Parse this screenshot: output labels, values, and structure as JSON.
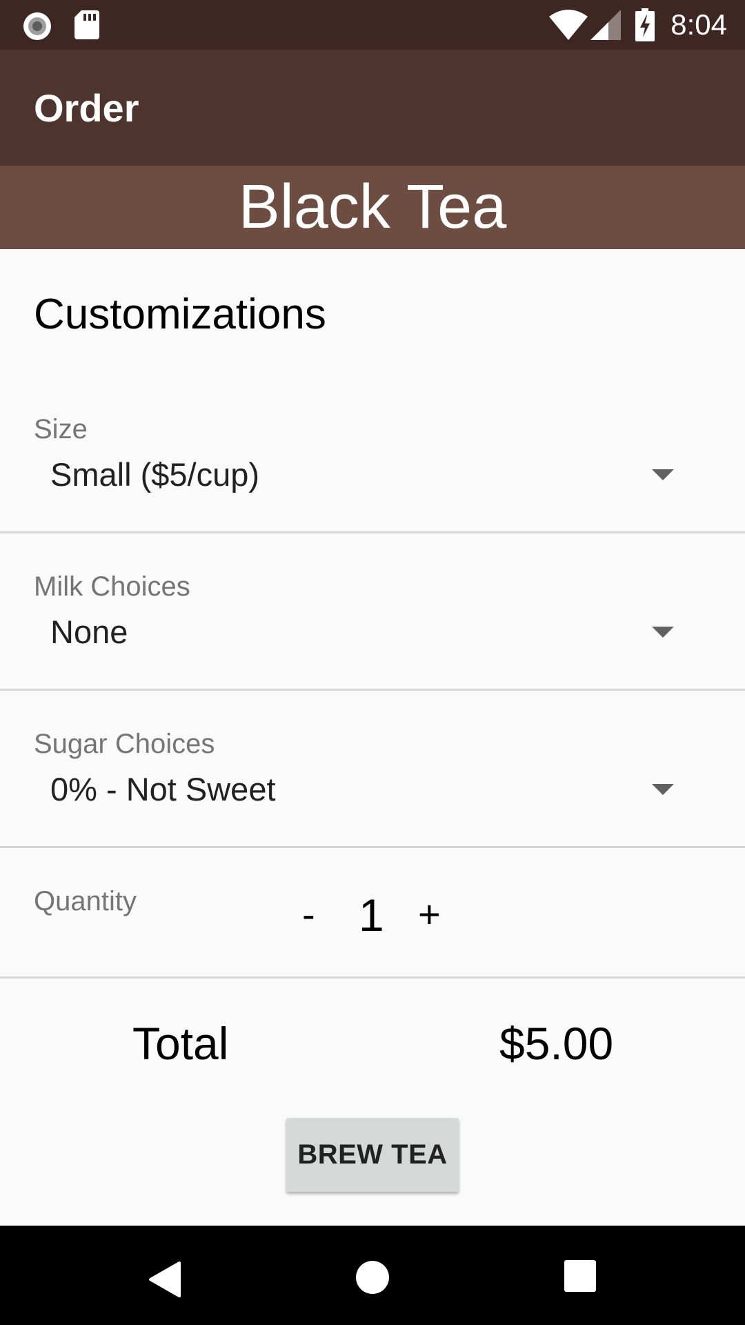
{
  "status_bar": {
    "time": "8:04",
    "left_icons": [
      "record-icon",
      "sd-card-icon"
    ],
    "right_icons": [
      "wifi-icon",
      "cell-signal-icon",
      "battery-charging-icon"
    ]
  },
  "app_bar": {
    "title": "Order"
  },
  "banner": {
    "tea_name": "Black Tea"
  },
  "customizations": {
    "title": "Customizations",
    "size": {
      "label": "Size",
      "value": "Small ($5/cup)"
    },
    "milk": {
      "label": "Milk Choices",
      "value": "None"
    },
    "sugar": {
      "label": "Sugar Choices",
      "value": "0% - Not Sweet"
    },
    "quantity": {
      "label": "Quantity",
      "decrement": "-",
      "value": "1",
      "increment": "+"
    }
  },
  "total": {
    "label": "Total",
    "value": "$5.00"
  },
  "brew_button": {
    "label": "BREW TEA"
  },
  "nav_bar": {
    "icons": [
      "back-icon",
      "home-icon",
      "recents-icon"
    ]
  },
  "colors": {
    "status_bar": "#3e2723",
    "app_bar": "#4e342e",
    "banner": "#6d4c41",
    "background": "#fafafa",
    "button": "#d6d7d7"
  }
}
